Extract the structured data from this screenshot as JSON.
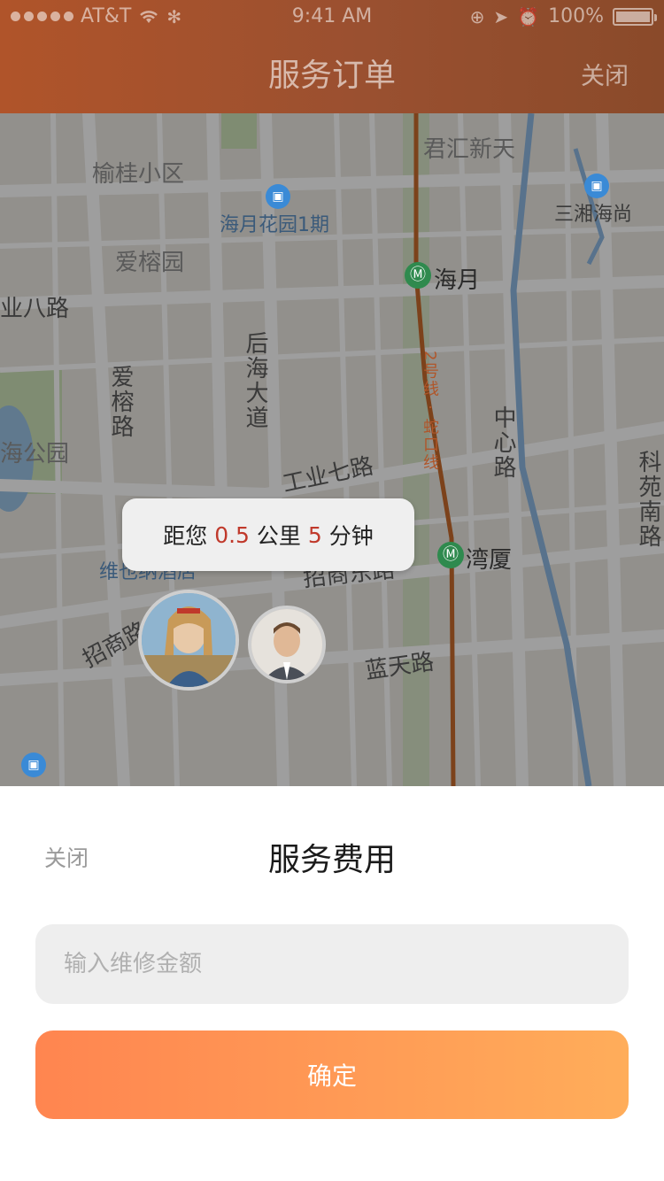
{
  "status_bar": {
    "carrier": "AT&T",
    "time": "9:41 AM",
    "battery": "100%"
  },
  "nav": {
    "title": "服务订单",
    "close_label": "关闭"
  },
  "map": {
    "labels": {
      "yugui": "榆桂小区",
      "haiyue_garden": "海月花园1期",
      "junhui": "君汇新天",
      "sanxiang": "三湘海尚",
      "airong_garden": "爱榕园",
      "gongye8": "业八路",
      "houhai": "后海大道",
      "airong_road": "爱榕路",
      "haiyue_station": "海月",
      "line2": "2号线 · 蛇口线",
      "zhongxin": "中心路",
      "keyuan": "科苑南路",
      "park": "海公园",
      "gongye7": "工业七路",
      "wanxia": "湾厦",
      "zhaoshang_east": "招商东路",
      "zhaoshang": "招商路",
      "lantian": "蓝天路",
      "weiyi": "维也纳酒店"
    },
    "icons": {
      "metro": "metro-icon",
      "poi": "building-icon"
    }
  },
  "distance_bubble": {
    "prefix": "距您",
    "distance": "0.5",
    "distance_unit": "公里",
    "minutes": "5",
    "minutes_unit": "分钟"
  },
  "sheet": {
    "close_label": "关闭",
    "title": "服务费用",
    "amount_placeholder": "输入维修金额",
    "confirm_label": "确定"
  },
  "colors": {
    "accent_start": "#ff8550",
    "accent_end": "#ffad5a",
    "highlight": "#c0392b"
  }
}
